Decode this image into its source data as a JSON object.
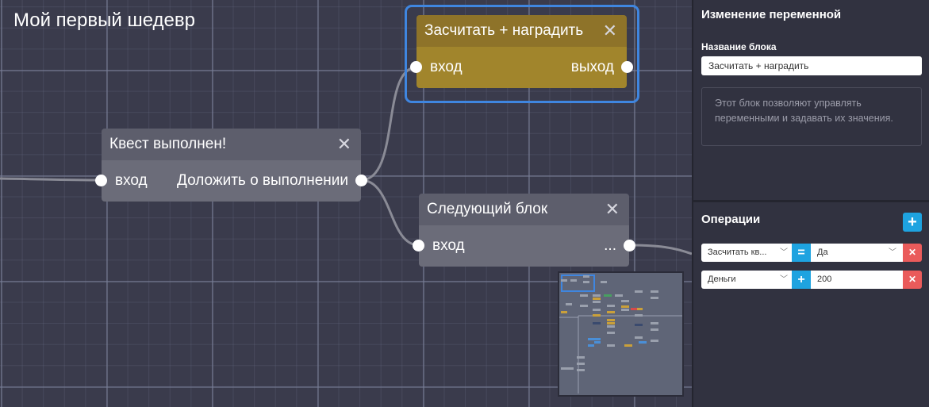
{
  "canvas": {
    "title": "Мой первый шедевр"
  },
  "nodes": {
    "quest_done": {
      "title": "Квест выполнен!",
      "input_label": "вход",
      "output_label": "Доложить о выполнении"
    },
    "reward": {
      "title": "Засчитать + наградить",
      "input_label": "вход",
      "output_label": "выход"
    },
    "next_block": {
      "title": "Следующий блок",
      "input_label": "вход",
      "output_label": "..."
    }
  },
  "icons": {
    "close": "close-icon",
    "add": "plus-icon",
    "delete": "x-icon",
    "dropdown": "chevron-down-icon"
  },
  "panel": {
    "title": "Изменение переменной",
    "block_name_label": "Название блока",
    "block_name_value": "Засчитать + наградить",
    "description": "Этот блок позволяют управлять переменными и задавать их значения.",
    "operations_title": "Операции",
    "operations": [
      {
        "variable": "Засчитать кв...",
        "operator": "=",
        "value": "Да"
      },
      {
        "variable": "Деньги",
        "operator": "+",
        "value": "200"
      }
    ]
  },
  "colors": {
    "accent": "#1ea3e0",
    "selection": "#3f86e0",
    "danger": "#ea5b5b",
    "gold_node": "#a1852c",
    "gray_node": "#6b6c79"
  }
}
